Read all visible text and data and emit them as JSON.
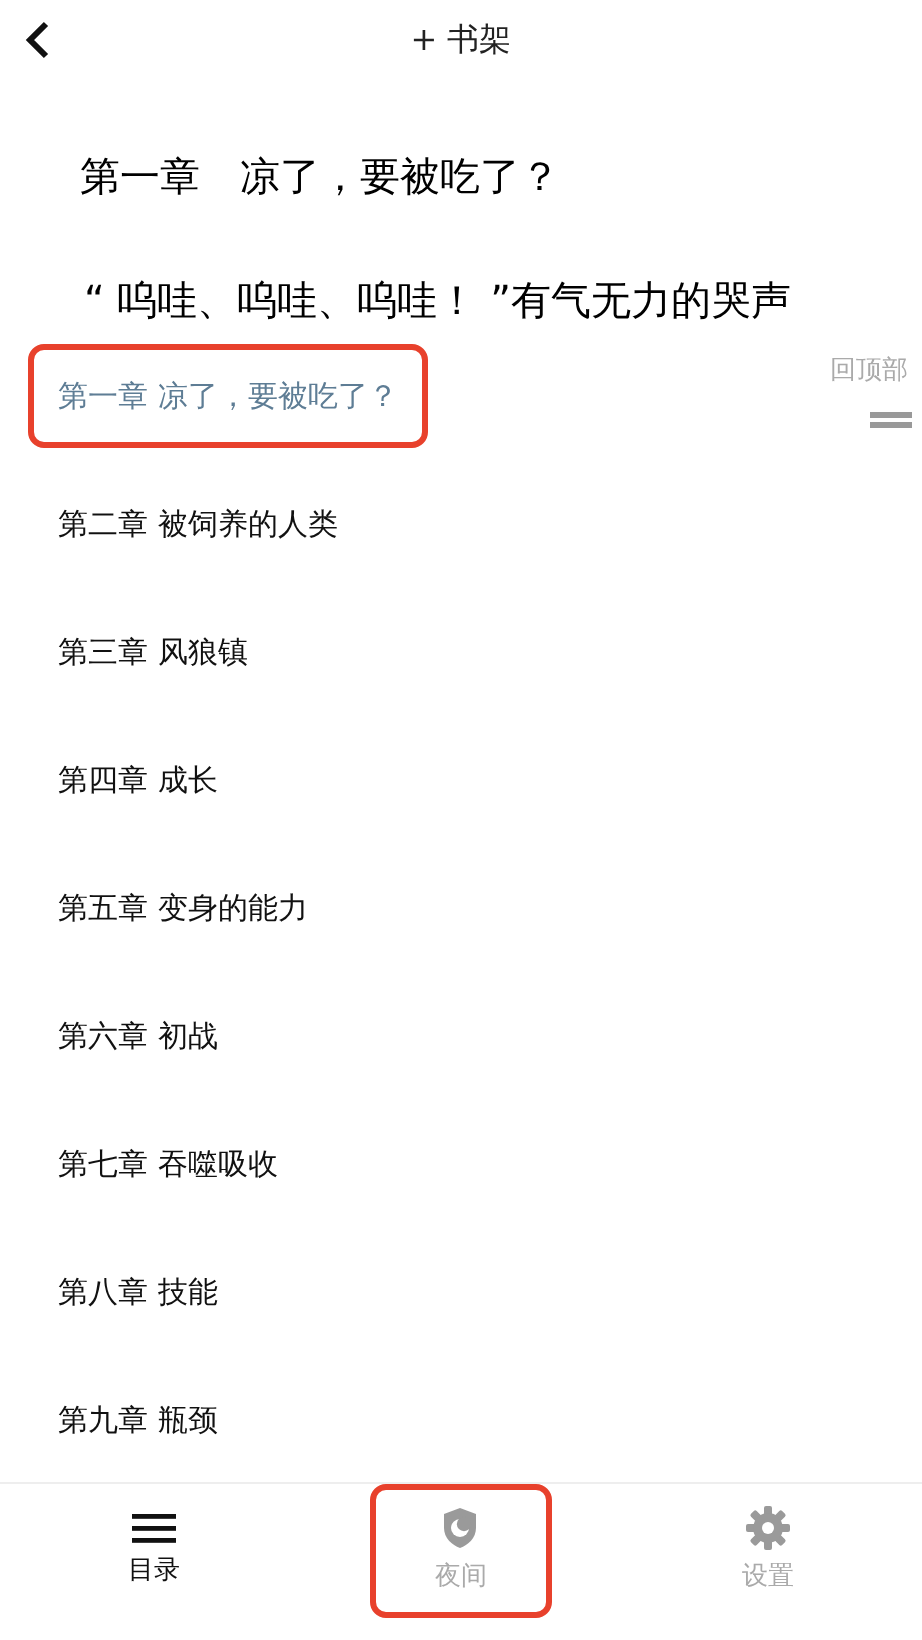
{
  "header": {
    "shelf_button": "+ 书架"
  },
  "content": {
    "chapter_title": "第一章　凉了，要被吃了？",
    "first_line": "“ 呜哇、呜哇、呜哇！ ”有气无力的哭声"
  },
  "back_to_top": "回顶部",
  "chapters": [
    {
      "title": "第一章 凉了，要被吃了？",
      "selected": true,
      "highlighted": true
    },
    {
      "title": "第二章 被饲养的人类",
      "selected": false,
      "highlighted": false
    },
    {
      "title": "第三章 风狼镇",
      "selected": false,
      "highlighted": false
    },
    {
      "title": "第四章 成长",
      "selected": false,
      "highlighted": false
    },
    {
      "title": "第五章 变身的能力",
      "selected": false,
      "highlighted": false
    },
    {
      "title": "第六章 初战",
      "selected": false,
      "highlighted": false
    },
    {
      "title": "第七章 吞噬吸收",
      "selected": false,
      "highlighted": false
    },
    {
      "title": "第八章 技能",
      "selected": false,
      "highlighted": false
    },
    {
      "title": "第九章 瓶颈",
      "selected": false,
      "highlighted": false
    }
  ],
  "tabs": [
    {
      "kind": "menu",
      "label": "目录",
      "selected": true,
      "highlighted": false
    },
    {
      "kind": "night",
      "label": "夜间",
      "selected": false,
      "highlighted": true
    },
    {
      "kind": "settings",
      "label": "设置",
      "selected": false,
      "highlighted": false
    }
  ]
}
